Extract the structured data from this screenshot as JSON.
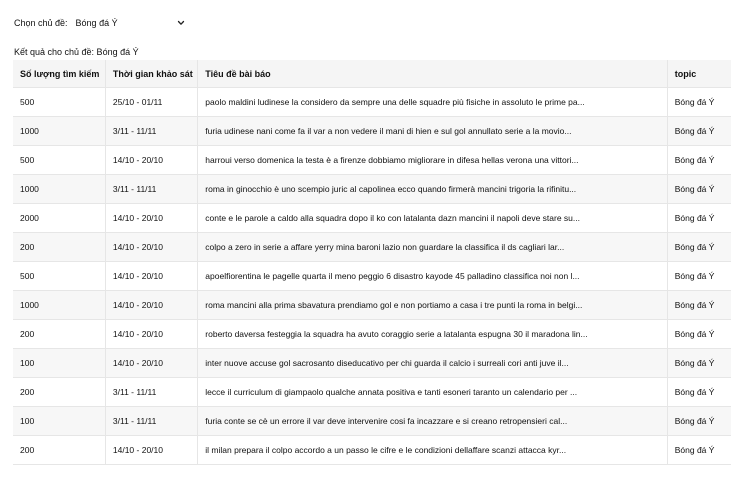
{
  "filter": {
    "label": "Chọn chủ đề:",
    "selected": "Bóng đá Ý"
  },
  "result_label": "Kết quả cho chủ đề: Bóng đá Ý",
  "table": {
    "headers": [
      "Số lượng tìm kiếm",
      "Thời gian khảo sát",
      "Tiêu đề bài báo",
      "topic"
    ],
    "rows": [
      [
        "500",
        "25/10 - 01/11",
        "paolo maldini ludinese la considero da sempre una delle squadre più fisiche in assoluto le prime pa...",
        "Bóng đá Ý"
      ],
      [
        "1000",
        "3/11 - 11/11",
        "furia udinese nani come fa il var a non vedere il mani di hien e sul gol annullato serie a la movio...",
        "Bóng đá Ý"
      ],
      [
        "500",
        "14/10 - 20/10",
        "harroui verso domenica la testa è a firenze dobbiamo migliorare in difesa hellas verona una vittori...",
        "Bóng đá Ý"
      ],
      [
        "1000",
        "3/11 - 11/11",
        "roma in ginocchio è uno scempio juric al capolinea ecco quando firmerà mancini trigoria la rifinitu...",
        "Bóng đá Ý"
      ],
      [
        "2000",
        "14/10 - 20/10",
        "conte e le parole a caldo alla squadra dopo il ko con latalanta dazn mancini il napoli deve stare su...",
        "Bóng đá Ý"
      ],
      [
        "200",
        "14/10 - 20/10",
        "colpo a zero in serie a affare yerry mina baroni lazio non guardare la classifica il ds cagliari lar...",
        "Bóng đá Ý"
      ],
      [
        "500",
        "14/10 - 20/10",
        "apoelfiorentina le pagelle quarta il meno peggio 6 disastro kayode 45 palladino classifica noi non l...",
        "Bóng đá Ý"
      ],
      [
        "1000",
        "14/10 - 20/10",
        "roma mancini alla prima sbavatura prendiamo gol e non portiamo a casa i tre punti la roma in belgi...",
        "Bóng đá Ý"
      ],
      [
        "200",
        "14/10 - 20/10",
        "roberto daversa festeggia la squadra ha avuto coraggio serie a latalanta espugna 30 il maradona lin...",
        "Bóng đá Ý"
      ],
      [
        "100",
        "14/10 - 20/10",
        "inter nuove accuse gol sacrosanto diseducativo per chi guarda il calcio i surreali cori anti juve il...",
        "Bóng đá Ý"
      ],
      [
        "200",
        "3/11 - 11/11",
        "lecce il curriculum di giampaolo qualche annata positiva e tanti esoneri taranto un calendario per ...",
        "Bóng đá Ý"
      ],
      [
        "100",
        "3/11 - 11/11",
        "furia conte se cè un errore il var deve intervenire cosi fa incazzare e si creano retropensieri cal...",
        "Bóng đá Ý"
      ],
      [
        "200",
        "14/10 - 20/10",
        "il milan prepara il colpo accordo a un passo le cifre e le condizioni dellaffare scanzi attacca kyr...",
        "Bóng đá Ý"
      ]
    ]
  }
}
